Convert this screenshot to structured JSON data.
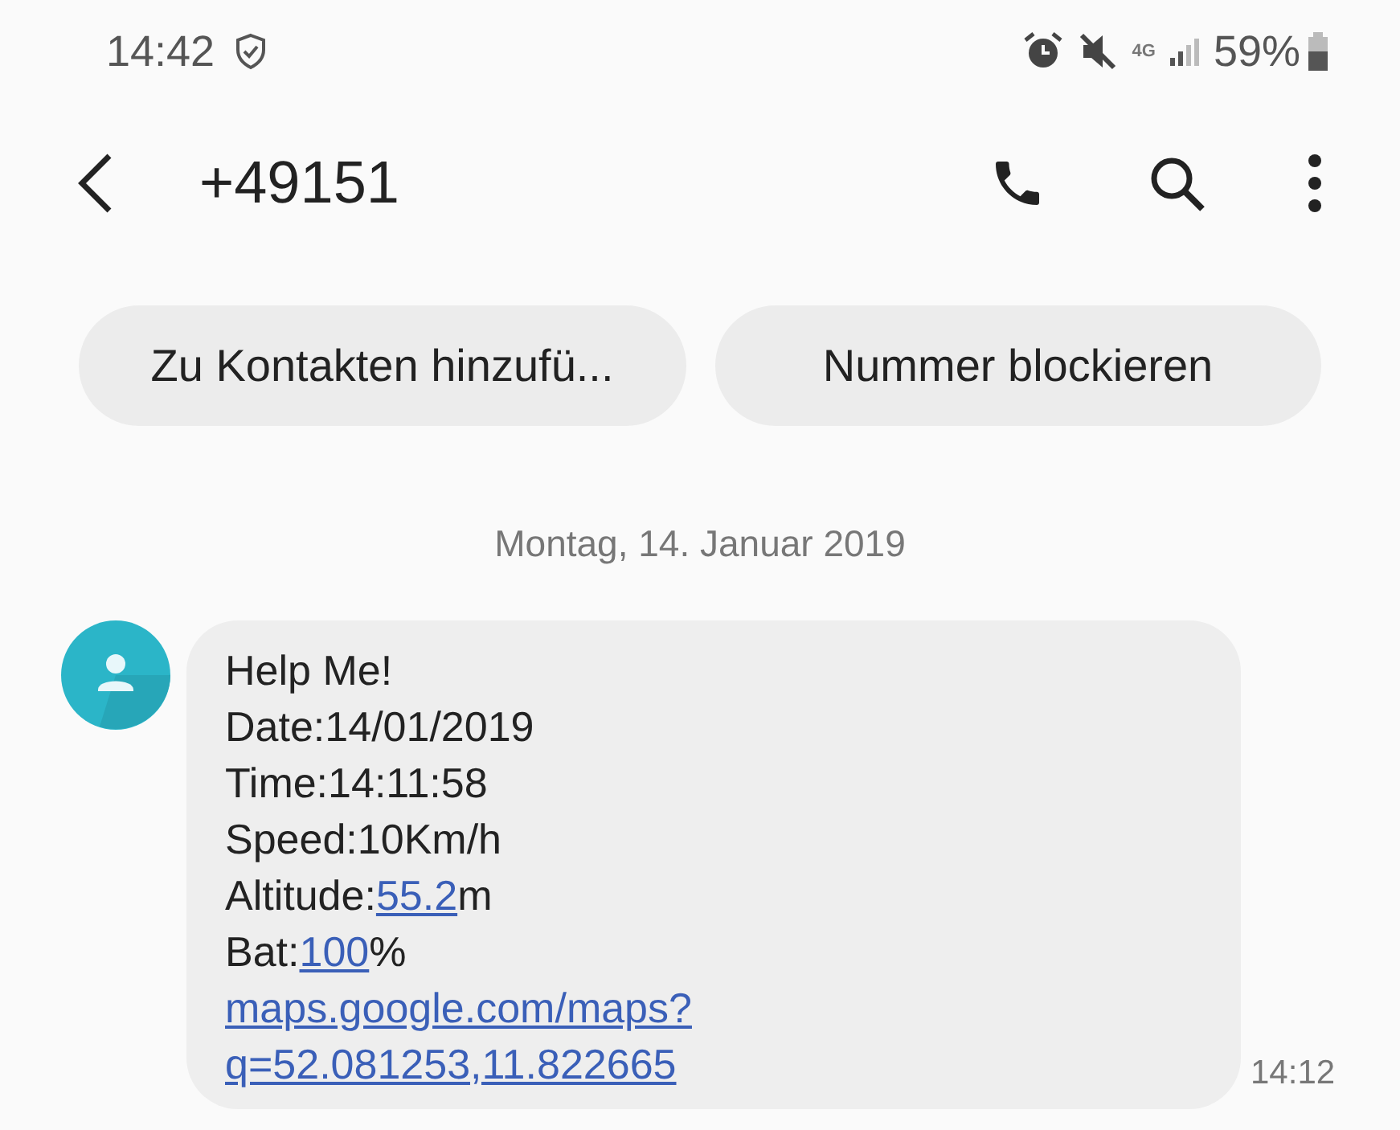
{
  "status_bar": {
    "time": "14:42",
    "network": "4G",
    "battery": "59%"
  },
  "header": {
    "title": "+49151"
  },
  "actions": [
    "Zu Kontakten hinzufü...",
    "Nummer blockieren"
  ],
  "date_divider": "Montag, 14. Januar 2019",
  "message": {
    "lines": [
      [
        {
          "text": "Help Me!",
          "link": false
        }
      ],
      [
        {
          "text": "Date:14/01/2019",
          "link": false
        }
      ],
      [
        {
          "text": "Time:14:11:58",
          "link": false
        }
      ],
      [
        {
          "text": "Speed:10Km/h",
          "link": false
        }
      ],
      [
        {
          "text": "Altitude:",
          "link": false
        },
        {
          "text": "55.2",
          "link": true
        },
        {
          "text": "m",
          "link": false
        }
      ],
      [
        {
          "text": "Bat:",
          "link": false
        },
        {
          "text": "100",
          "link": true
        },
        {
          "text": "%",
          "link": false
        }
      ],
      [
        {
          "text": "maps.google.com/maps?",
          "link": true
        }
      ],
      [
        {
          "text": "q=52.081253,11.822665",
          "link": true
        }
      ]
    ],
    "time": "14:12"
  }
}
